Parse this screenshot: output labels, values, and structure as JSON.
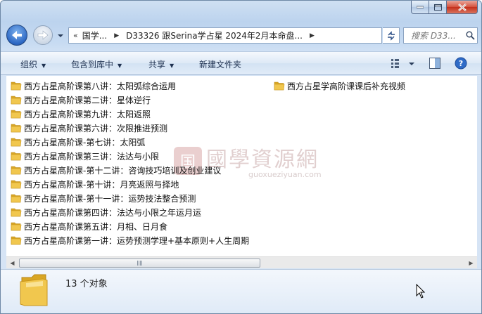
{
  "window": {
    "buttons": {
      "minimize": "minimize",
      "maximize": "maximize",
      "close": "close"
    }
  },
  "address": {
    "overflow": "«",
    "crumbs": [
      "国学...",
      "D33326 跟Serina学占星 2024年2月本命盘..."
    ]
  },
  "search": {
    "placeholder": "搜索 D33..."
  },
  "toolbar": {
    "organize": "组织",
    "include_in_library": "包含到库中",
    "share": "共享",
    "new_folder": "新建文件夹"
  },
  "files_left": [
    "西方占星高阶课第八讲：太阳弧综合运用",
    "西方占星高阶课第二讲：星体逆行",
    "西方占星高阶课第九讲：太阳返照",
    "西方占星高阶课第六讲：次限推进预测",
    "西方占星高阶课-第七讲：太阳弧",
    "西方占星高阶课第三讲：法达与小限",
    "西方占星高阶课-第十二讲：咨询技巧培训及创业建议",
    "西方占星高阶课-第十讲：月亮返照与择地",
    "西方占星高阶课-第十一讲：运势技法整合预测",
    "西方占星高阶课第四讲：法达与小限之年运月运",
    "西方占星高阶课第五讲：月相、日月食",
    "西方占星高阶课第一讲：运势预测学理+基本原则+人生周期"
  ],
  "files_right": [
    "西方占星学高阶课课后补充视频"
  ],
  "watermark": {
    "seal": "国",
    "text": "國學資源網",
    "url": "guoxueziyuan.com"
  },
  "details": {
    "count": "13 个对象"
  },
  "colors": {
    "folder": "#e8b83a",
    "accent": "#2d68c4"
  }
}
